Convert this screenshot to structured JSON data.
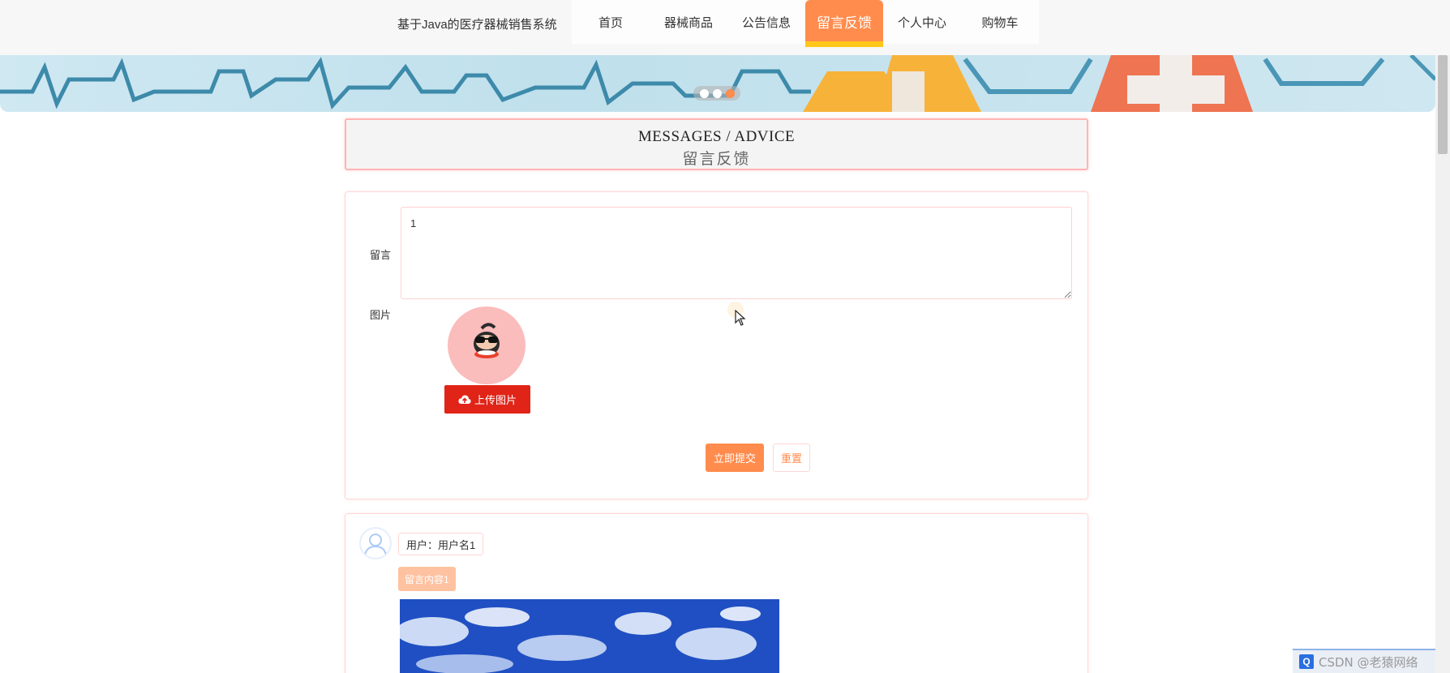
{
  "site": {
    "title": "基于Java的医疗器械销售系统"
  },
  "nav": {
    "items": [
      {
        "label": "首页"
      },
      {
        "label": "器械商品"
      },
      {
        "label": "公告信息"
      },
      {
        "label": "留言反馈"
      },
      {
        "label": "个人中心"
      },
      {
        "label": "购物车"
      }
    ],
    "active_index": 3
  },
  "banner": {
    "slide_count": 3,
    "active_slide": 3
  },
  "section": {
    "title_en": "MESSAGES / ADVICE",
    "title_cn": "留言反馈"
  },
  "form": {
    "message_label": "留言",
    "message_value": "1",
    "image_label": "图片",
    "upload_label": "上传图片",
    "submit_label": "立即提交",
    "reset_label": "重置"
  },
  "comments": [
    {
      "user_label": "用户：用户名1",
      "content": "留言内容1"
    }
  ],
  "watermark": {
    "text": "CSDN @老猿网络",
    "icon": "Q"
  },
  "colors": {
    "accent": "#ff8c4d",
    "upload": "#e02417",
    "highlight": "#ffc71a",
    "border": "#ffd6d6"
  }
}
